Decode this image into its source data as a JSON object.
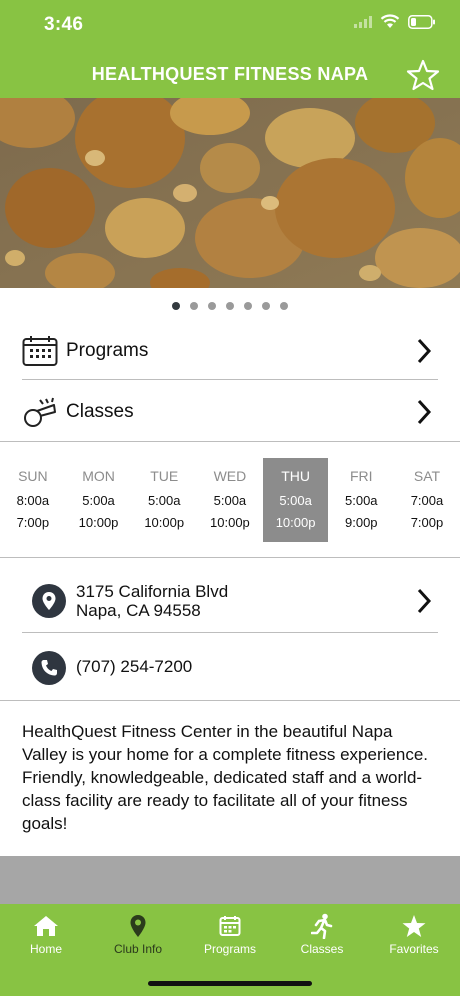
{
  "status_bar": {
    "time": "3:46",
    "icons": [
      "signal-icon",
      "wifi-icon",
      "battery-icon"
    ]
  },
  "header": {
    "title": "HEALTHQUEST FITNESS NAPA",
    "favorite_icon": "star-outline-icon"
  },
  "carousel": {
    "total": 7,
    "active_index": 0
  },
  "menu": [
    {
      "label": "Programs",
      "icon": "calendar-icon"
    },
    {
      "label": "Classes",
      "icon": "whistle-icon"
    }
  ],
  "schedule": [
    {
      "day": "SUN",
      "open": "8:00a",
      "close": "7:00p",
      "active": false
    },
    {
      "day": "MON",
      "open": "5:00a",
      "close": "10:00p",
      "active": false
    },
    {
      "day": "TUE",
      "open": "5:00a",
      "close": "10:00p",
      "active": false
    },
    {
      "day": "WED",
      "open": "5:00a",
      "close": "10:00p",
      "active": false
    },
    {
      "day": "THU",
      "open": "5:00a",
      "close": "10:00p",
      "active": true
    },
    {
      "day": "FRI",
      "open": "5:00a",
      "close": "9:00p",
      "active": false
    },
    {
      "day": "SAT",
      "open": "7:00a",
      "close": "7:00p",
      "active": false
    }
  ],
  "address": {
    "line1": "3175 California Blvd",
    "line2": "Napa, CA 94558",
    "icon": "location-pin-icon"
  },
  "phone": {
    "number": "(707) 254-7200",
    "icon": "phone-icon"
  },
  "description": "HealthQuest Fitness Center in the beautiful Napa Valley is your home for a complete fitness experience. Friendly, knowledgeable, dedicated staff and a world-class facility are ready to facilitate all of your fitness goals!",
  "tabbar": [
    {
      "label": "Home",
      "icon": "home-icon",
      "active": false
    },
    {
      "label": "Club Info",
      "icon": "location-pin-icon",
      "active": true
    },
    {
      "label": "Programs",
      "icon": "calendar-icon",
      "active": false
    },
    {
      "label": "Classes",
      "icon": "runner-icon",
      "active": false
    },
    {
      "label": "Favorites",
      "icon": "star-icon",
      "active": false
    }
  ],
  "colors": {
    "brand_green": "#88c343",
    "active_day": "#8c8c8c",
    "dark_icon": "#2f3640",
    "gray_band": "#a6a6a6"
  }
}
